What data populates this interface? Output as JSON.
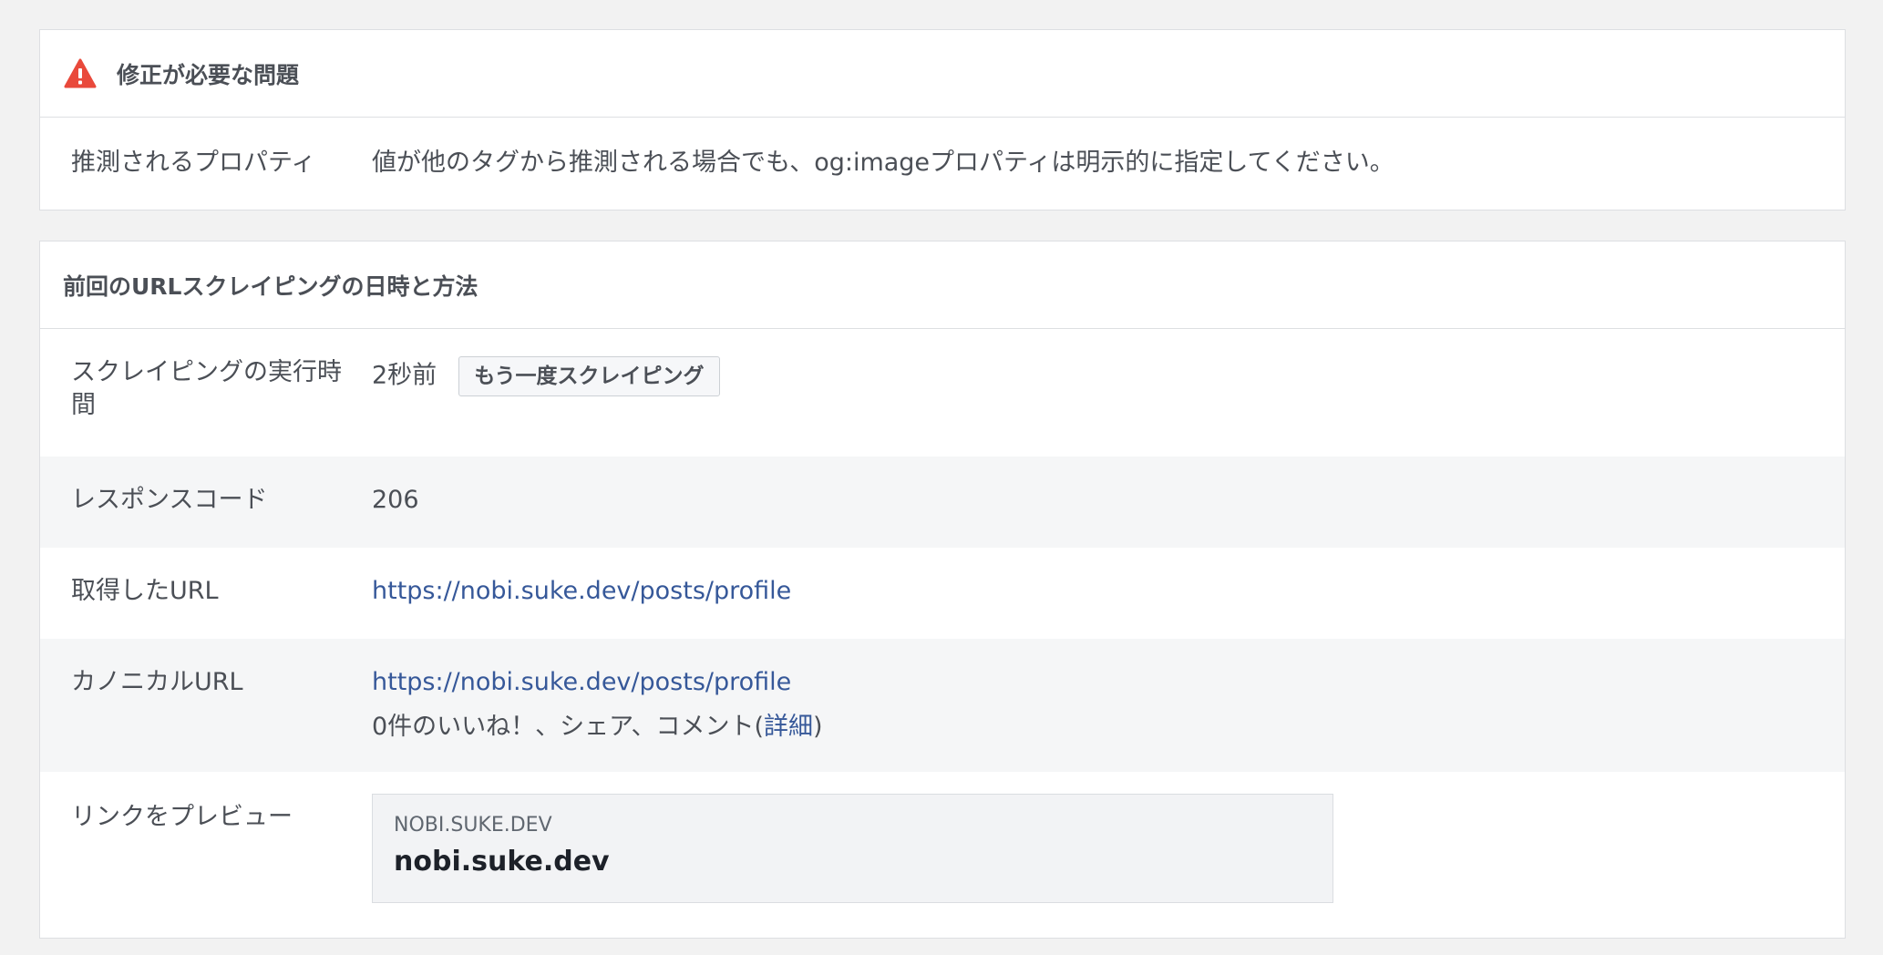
{
  "issues": {
    "header": "修正が必要な問題",
    "rows": [
      {
        "label": "推測されるプロパティ",
        "value": "値が他のタグから推測される場合でも、og:imageプロパティは明示的に指定してください。"
      }
    ]
  },
  "scrape": {
    "header": "前回のURLスクレイピングの日時と方法",
    "time": {
      "label": "スクレイピングの実行時間",
      "value": "2秒前",
      "button": "もう一度スクレイピング"
    },
    "response": {
      "label": "レスポンスコード",
      "value": "206"
    },
    "fetched": {
      "label": "取得したURL",
      "value": "https://nobi.suke.dev/posts/profile"
    },
    "canonical": {
      "label": "カノニカルURL",
      "value": "https://nobi.suke.dev/posts/profile",
      "engagement_text": "0件のいいね！、シェア、コメント(",
      "details_link": "詳細",
      "close_paren": ")"
    },
    "preview": {
      "label": "リンクをプレビュー",
      "domain": "NOBI.SUKE.DEV",
      "title": "nobi.suke.dev"
    }
  },
  "colors": {
    "warning": "#e9493b",
    "link": "#365899"
  }
}
